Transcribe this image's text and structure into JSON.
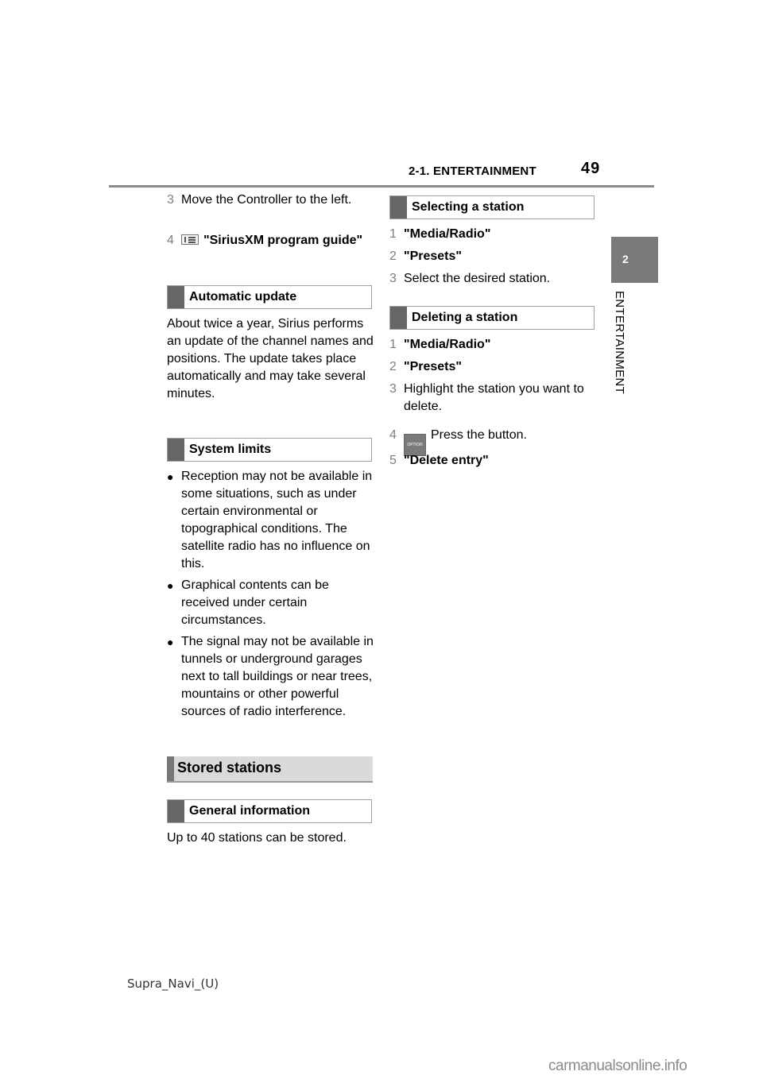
{
  "header": {
    "section": "2-1. ENTERTAINMENT",
    "page_number": "49"
  },
  "chapter_tab": {
    "number": "2",
    "label": "ENTERTAINMENT"
  },
  "left_column": {
    "steps_top": [
      {
        "num": "3",
        "text": "Move the Controller to the left."
      },
      {
        "num": "4",
        "icon": "list-menu-icon",
        "text": "\"SiriusXM program guide\""
      }
    ],
    "automatic_update": {
      "heading": "Automatic update",
      "body": "About twice a year, Sirius performs an update of the channel names and positions. The update takes place automatically and may take several minutes."
    },
    "system_limits": {
      "heading": "System limits",
      "bullets": [
        "Reception may not be available in some situations, such as under certain environmental or topographical conditions. The satellite radio has no influence on this.",
        "Graphical contents can be received under certain circumstances.",
        "The signal may not be available in tunnels or underground garages next to tall buildings or near trees, mountains or other powerful sources of radio interference."
      ]
    },
    "stored_stations": {
      "heading": "Stored stations",
      "general_information": {
        "heading": "General information",
        "body": "Up to 40 stations can be stored."
      }
    }
  },
  "right_column": {
    "selecting_station": {
      "heading": "Selecting a station",
      "steps": [
        {
          "num": "1",
          "text": "\"Media/Radio\"",
          "bold": true
        },
        {
          "num": "2",
          "text": "\"Presets\"",
          "bold": true
        },
        {
          "num": "3",
          "text": "Select the desired station.",
          "bold": false
        }
      ]
    },
    "deleting_station": {
      "heading": "Deleting a station",
      "steps": [
        {
          "num": "1",
          "text": "\"Media/Radio\"",
          "bold": true
        },
        {
          "num": "2",
          "text": "\"Presets\"",
          "bold": true
        },
        {
          "num": "3",
          "text": "Highlight the station you want to delete.",
          "bold": false
        },
        {
          "num": "4",
          "icon": "option-button-icon",
          "icon_label": "OPTION",
          "text": "Press the button.",
          "bold": false
        },
        {
          "num": "5",
          "text": "\"Delete entry\"",
          "bold": true
        }
      ]
    }
  },
  "footer": {
    "doc_id": "Supra_Navi_(U)"
  },
  "watermark": "carmanualsonline.info"
}
